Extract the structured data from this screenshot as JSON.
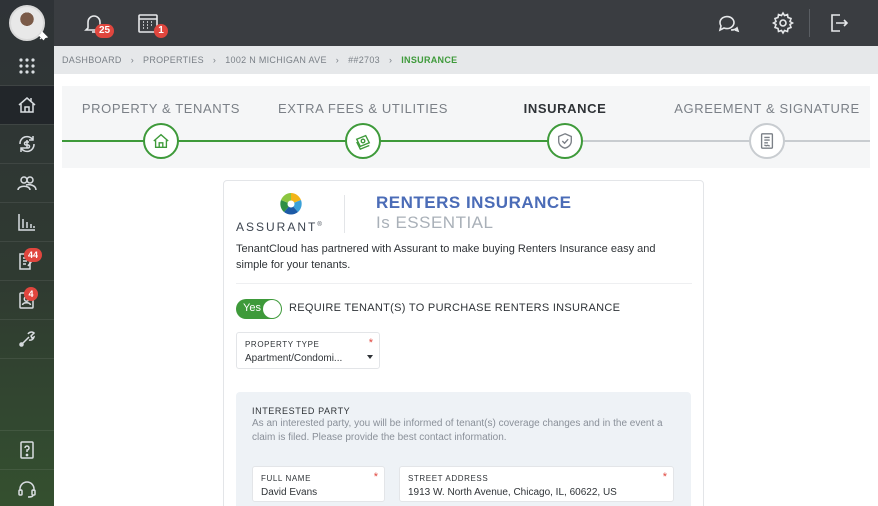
{
  "topbar": {
    "notifications_count": "25",
    "calendar_count": "1"
  },
  "sidebar": {
    "items": [
      {
        "name": "apps",
        "icon": "grid-icon"
      },
      {
        "name": "properties",
        "icon": "house-icon",
        "active": true
      },
      {
        "name": "transactions",
        "icon": "money-cycle-icon"
      },
      {
        "name": "tenants",
        "icon": "people-icon"
      },
      {
        "name": "reports",
        "icon": "bar-chart-icon"
      },
      {
        "name": "applications",
        "icon": "document-icon",
        "badge": "44"
      },
      {
        "name": "leases",
        "icon": "contact-card-icon",
        "badge": "4"
      },
      {
        "name": "tools",
        "icon": "wrench-icon"
      },
      {
        "name": "help",
        "icon": "question-doc-icon"
      },
      {
        "name": "support",
        "icon": "headset-icon"
      }
    ]
  },
  "breadcrumb": [
    "DASHBOARD",
    "PROPERTIES",
    "1002 N MICHIGAN AVE",
    "##2703",
    "INSURANCE"
  ],
  "steps": [
    {
      "label": "PROPERTY & TENANTS",
      "state": "done"
    },
    {
      "label": "EXTRA FEES & UTILITIES",
      "state": "done"
    },
    {
      "label": "INSURANCE",
      "state": "active"
    },
    {
      "label": "AGREEMENT & SIGNATURE",
      "state": "pending"
    }
  ],
  "card": {
    "logo_text": "ASSURANT",
    "logo_mark": "®",
    "title": "RENTERS INSURANCE",
    "subtitle": "Is ESSENTIAL",
    "description": "TenantCloud has partnered with Assurant to make buying Renters Insurance easy and simple for your tenants.",
    "toggle_label": "Yes",
    "require_label": "REQUIRE TENANT(S) TO PURCHASE RENTERS INSURANCE",
    "property_type": {
      "label": "PROPERTY TYPE",
      "value": "Apartment/Condomi..."
    },
    "interested_party": {
      "title": "INTERESTED PARTY",
      "description": "As an interested party, you will be informed of tenant(s) coverage changes and in the event a claim is filed. Please provide the best contact information.",
      "full_name": {
        "label": "FULL NAME",
        "value": "David Evans"
      },
      "street_address": {
        "label": "STREET ADDRESS",
        "value": "1913 W. North Avenue, Chicago, IL, 60622, US"
      }
    }
  },
  "colors": {
    "accent_green": "#3e9a3a",
    "title_blue": "#4b6cb7",
    "badge_red": "#e0463e"
  }
}
